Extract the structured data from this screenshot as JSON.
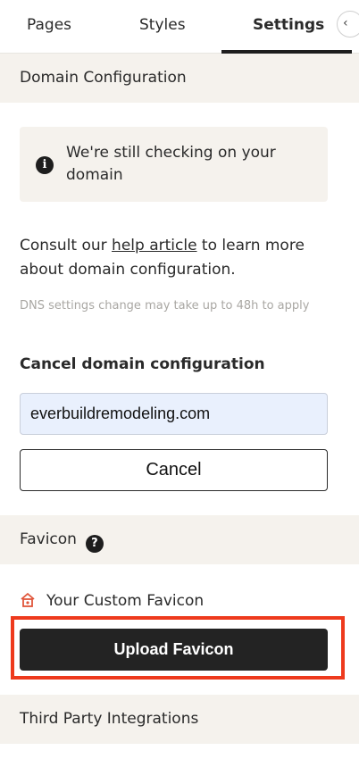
{
  "tabs": [
    {
      "label": "Pages"
    },
    {
      "label": "Styles"
    },
    {
      "label": "Settings",
      "active": true
    }
  ],
  "domain_config": {
    "header": "Domain Configuration",
    "notice": "We're still checking on your domain",
    "consult_prefix": "Consult our ",
    "help_link": "help article",
    "consult_suffix": " to learn more about domain configuration.",
    "dns_note": "DNS settings change may take up to 48h to apply",
    "cancel_heading": "Cancel domain configuration",
    "domain_value": "everbuildremodeling.com",
    "cancel_label": "Cancel"
  },
  "favicon": {
    "header": "Favicon",
    "custom_label": "Your Custom Favicon",
    "upload_label": "Upload Favicon"
  },
  "third_party": {
    "header": "Third Party Integrations"
  },
  "colors": {
    "accent_highlight": "#ee3a1d",
    "section_bg": "#f5f2ed",
    "input_bg": "#e9f0fd"
  }
}
